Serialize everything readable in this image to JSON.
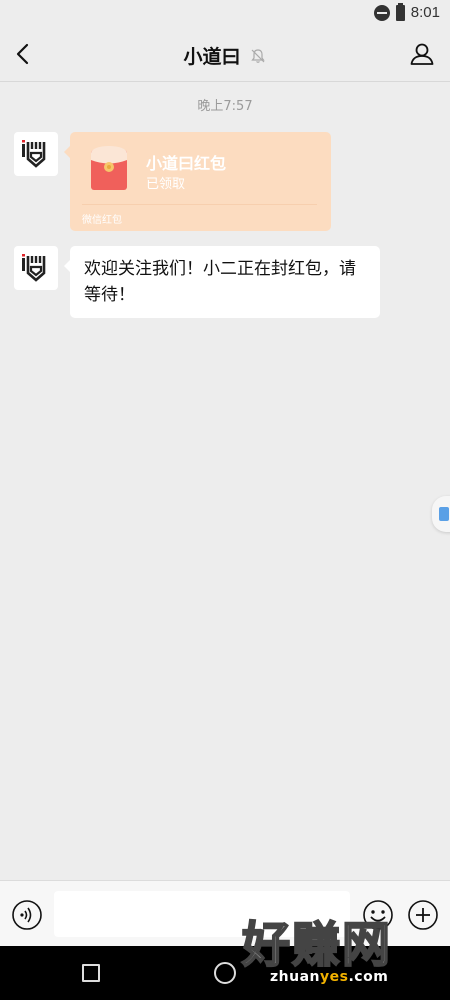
{
  "status_bar": {
    "time": "8:01"
  },
  "header": {
    "title": "小道曰"
  },
  "chat": {
    "timestamp": "晚上7:57",
    "messages": [
      {
        "type": "red_packet",
        "title": "小道曰红包",
        "status": "已领取",
        "label": "微信红包"
      },
      {
        "type": "text",
        "text": "欢迎关注我们！小二正在封红包，请等待！"
      }
    ]
  },
  "input": {
    "value": "",
    "placeholder": ""
  },
  "watermark": {
    "text": "好赚网",
    "url_prefix": "zhuan",
    "url_highlight": "yes",
    "url_suffix": ".com"
  },
  "colors": {
    "background": "#ededed",
    "packet_bg": "#fcdcc0",
    "packet_red": "#f0605b",
    "nav_bar": "#000000"
  }
}
